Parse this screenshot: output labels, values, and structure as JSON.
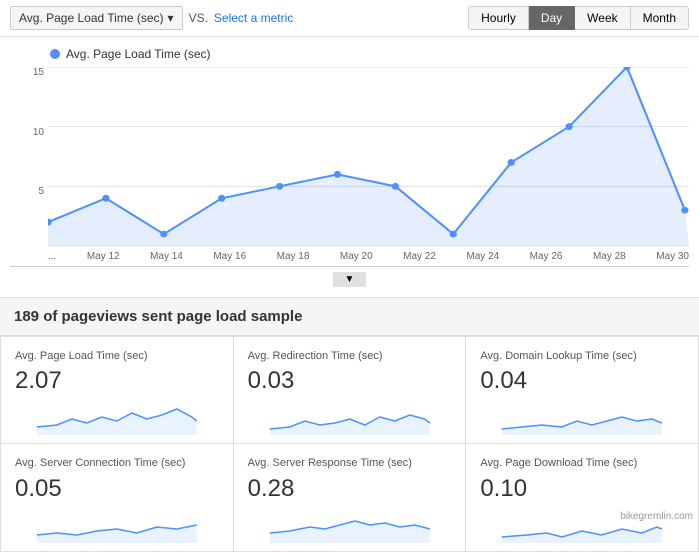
{
  "topbar": {
    "metric_label": "Avg. Page Load Time (sec)",
    "vs_label": "VS.",
    "select_metric_label": "Select a metric",
    "time_buttons": [
      "Hourly",
      "Day",
      "Week",
      "Month"
    ],
    "active_time": "Day"
  },
  "chart": {
    "legend_label": "Avg. Page Load Time (sec)",
    "y_labels": [
      "15",
      "10",
      "5",
      ""
    ],
    "x_labels": [
      "...",
      "May 12",
      "May 14",
      "May 16",
      "May 18",
      "May 20",
      "May 22",
      "May 24",
      "May 26",
      "May 28",
      "May 30"
    ],
    "scroll_label": "▼"
  },
  "summary": {
    "text": "189 of pageviews sent page load sample"
  },
  "metric_cards": [
    {
      "title": "Avg. Page Load Time (sec)",
      "value": "2.07"
    },
    {
      "title": "Avg. Redirection Time (sec)",
      "value": "0.03"
    },
    {
      "title": "Avg. Domain Lookup Time (sec)",
      "value": "0.04"
    },
    {
      "title": "Avg. Server Connection Time (sec)",
      "value": "0.05"
    },
    {
      "title": "Avg. Server Response Time (sec)",
      "value": "0.28"
    },
    {
      "title": "Avg. Page Download Time (sec)",
      "value": "0.10"
    }
  ],
  "watermark": "bikegremlin.com"
}
